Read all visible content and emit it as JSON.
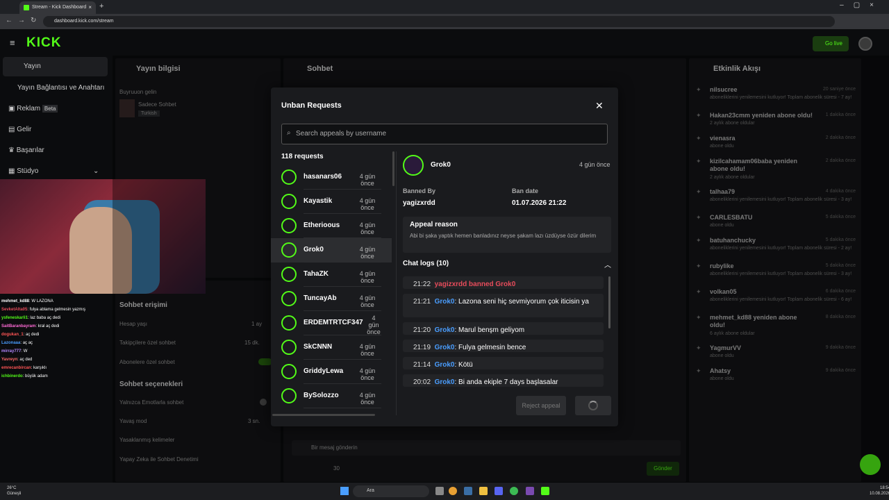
{
  "browser": {
    "tab_title": "Stream - Kick Dashboard",
    "url": "dashboard.kick.com/stream"
  },
  "header": {
    "logo": "KICK",
    "go_live": "Go live"
  },
  "sidebar": {
    "items": [
      {
        "label": "Yayın",
        "icon": "video-icon"
      },
      {
        "label": "Yayın Bağlantısı ve Anahtarı"
      },
      {
        "label": "Reklam",
        "badge": "Beta",
        "icon": "ad-icon"
      },
      {
        "label": "Gelir",
        "icon": "chart-icon"
      },
      {
        "label": "Başarılar",
        "icon": "trophy-icon"
      },
      {
        "label": "Stüdyo",
        "icon": "studio-icon"
      }
    ]
  },
  "overlay_chat": [
    {
      "user": "mehmet_kd88",
      "msg": "W LAZONA",
      "color": "#ffffff"
    },
    {
      "user": "SevketAlta05",
      "msg": "fulya ablama gelmesin yazmış",
      "color": "#e74c5b"
    },
    {
      "user": "ysfeneskarli1",
      "msg": "laz baba aç dedi",
      "color": "#53fc18"
    },
    {
      "user": "SaitBaranbayram",
      "msg": "kral aç dedi",
      "color": "#ff6bd6"
    },
    {
      "user": "dogukan_1",
      "msg": "aç dedi",
      "color": "#ff5555"
    },
    {
      "user": "Lazonaaa",
      "msg": "aç aç",
      "color": "#4a9eff"
    },
    {
      "user": "mirray777",
      "msg": "W",
      "color": "#b388ff"
    },
    {
      "user": "Yavreyn",
      "msg": "aç ded",
      "color": "#ff6b6b"
    },
    {
      "user": "emrecanbircan",
      "msg": "karşıklı",
      "color": "#ff5555"
    },
    {
      "user": "ichbinerdo",
      "msg": "büyük adam",
      "color": "#53fc18"
    }
  ],
  "bg": {
    "stream_info_title": "Yayın bilgisi",
    "stream_title": "Buyruuon gelin",
    "category": "Sadece Sohbet",
    "lang_tag": "Turkish",
    "chat_title": "Sohbet",
    "activity_title": "Etkinlik Akışı",
    "chat_access": "Sohbet erişimi",
    "account_age": "Hesap yaşı",
    "account_age_val": "1 ay",
    "followers_only": "Takipçilere özel sohbet",
    "followers_val": "15 dk.",
    "subs_only": "Abonelere özel sohbet",
    "chat_options": "Sohbet seçenekleri",
    "emote_only": "Yalnızca Emotlarla sohbet",
    "slow_mode": "Yavaş mod",
    "slow_val": "3 sn.",
    "banned_words": "Yasaklanmış kelimeler",
    "ai_mod": "Yapay Zeka ile Sohbet Denetimi",
    "send_placeholder": "Bir mesaj gönderin",
    "send_btn": "Gönder",
    "count": "30"
  },
  "activity": [
    {
      "name": "nilsucree",
      "time": "20 saniye önce",
      "sub": "aboneliklerini yenilemesini kutluyor! Toplam abonelik süresi - 7 ay!"
    },
    {
      "name": "Hakan23cmm yeniden abone oldu!",
      "time": "1 dakika önce",
      "sub": "2 aylık abone oldular"
    },
    {
      "name": "vienasra",
      "time": "2 dakika önce",
      "sub": "abone oldu"
    },
    {
      "name": "kizilcahamam06baba yeniden abone oldu!",
      "time": "2 dakika önce",
      "sub": "2 aylık abone oldular"
    },
    {
      "name": "talhaa79",
      "time": "4 dakika önce",
      "sub": "aboneliklerini yenilemesini kutluyor! Toplam abonelik süresi - 3 ay!"
    },
    {
      "name": "CARLESBATU",
      "time": "5 dakika önce",
      "sub": "abone oldu"
    },
    {
      "name": "batuhanchucky",
      "time": "5 dakika önce",
      "sub": "aboneliklerini yenilemesini kutluyor! Toplam abonelik süresi - 2 ay!"
    },
    {
      "name": "rubylike",
      "time": "5 dakika önce",
      "sub": "aboneliklerini yenilemesini kutluyor! Toplam abonelik süresi - 3 ay!"
    },
    {
      "name": "volkan05",
      "time": "6 dakika önce",
      "sub": "aboneliklerini yenilemesini kutluyor! Toplam abonelik süresi - 6 ay!"
    },
    {
      "name": "mehmet_kd88 yeniden abone oldu!",
      "time": "8 dakika önce",
      "sub": "6 aylık abone oldular"
    },
    {
      "name": "YagmurVV",
      "time": "9 dakika önce",
      "sub": "abone oldu"
    },
    {
      "name": "Ahatsy",
      "time": "9 dakika önce",
      "sub": "abone oldu"
    }
  ],
  "modal": {
    "title": "Unban Requests",
    "search_placeholder": "Search appeals by username",
    "count_label": "118 requests",
    "requests": [
      {
        "name": "hasanars06",
        "time": "4 gün önce"
      },
      {
        "name": "Kayastik",
        "time": "4 gün önce"
      },
      {
        "name": "Etherioous",
        "time": "4 gün önce"
      },
      {
        "name": "Grok0",
        "time": "4 gün önce",
        "selected": true
      },
      {
        "name": "TahaZK",
        "time": "4 gün önce"
      },
      {
        "name": "TuncayAb",
        "time": "4 gün önce"
      },
      {
        "name": "ERDEMTRTCF347",
        "time": "4 gün önce"
      },
      {
        "name": "SkCNNN",
        "time": "4 gün önce"
      },
      {
        "name": "GriddyLewa",
        "time": "4 gün önce"
      },
      {
        "name": "BySolozzo",
        "time": "4 gün önce"
      }
    ],
    "detail": {
      "name": "Grok0",
      "time": "4 gün önce",
      "banned_by_label": "Banned By",
      "banned_by": "yagizxrdd",
      "ban_date_label": "Ban date",
      "ban_date": "01.07.2026 21:22",
      "reason_title": "Appeal reason",
      "reason_text": "Abi bi şaka yaptık hemen banladınız neyse şakam lazı üzdüyse özür dilerim",
      "logs_title": "Chat logs (10)",
      "logs": [
        {
          "time": "21:22",
          "ban": "yagizxrdd banned Grok0"
        },
        {
          "time": "21:21",
          "user": "Grok0",
          "msg": ": Lazona seni hiç sevmiyorum çok iticisin ya"
        },
        {
          "time": "21:20",
          "user": "Grok0",
          "msg": ": Marul benşm geliyom"
        },
        {
          "time": "21:19",
          "user": "Grok0",
          "msg": ": Fulya gelmesin bence"
        },
        {
          "time": "21:14",
          "user": "Grok0",
          "msg": ": Kötü"
        },
        {
          "time": "20:02",
          "user": "Grok0",
          "msg": ": Bi anda ekiple 7 days başlasalar"
        }
      ],
      "reject_label": "Reject appeal"
    }
  },
  "taskbar": {
    "temp": "26°C",
    "weather": "Güneşli",
    "search": "Ara",
    "time": "18:54",
    "date": "10.08.2026"
  }
}
